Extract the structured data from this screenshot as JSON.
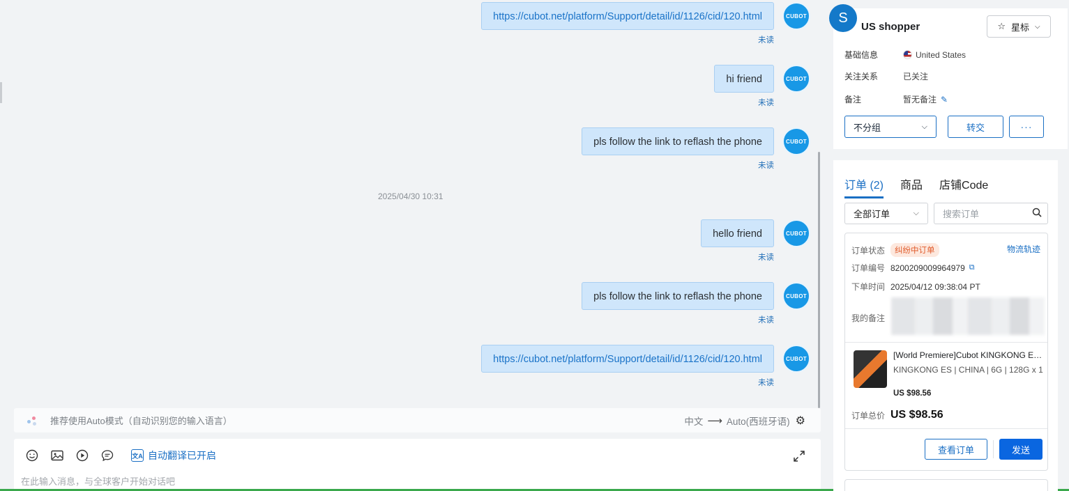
{
  "chat": {
    "avatar_label": "CUBOT",
    "time_separator": "2025/04/30 10:31",
    "messages": [
      {
        "text": "https://cubot.net/platform/Support/detail/id/1126/cid/120.html",
        "status": "未读",
        "is_link": true
      },
      {
        "text": "hi friend",
        "status": "未读",
        "is_link": false
      },
      {
        "text": "pls follow the link to reflash the phone",
        "status": "未读",
        "is_link": false
      },
      {
        "text": "hello friend",
        "status": "未读",
        "is_link": false
      },
      {
        "text": "pls follow the link to reflash the phone",
        "status": "未读",
        "is_link": false
      },
      {
        "text": "https://cubot.net/platform/Support/detail/id/1126/cid/120.html",
        "status": "未读",
        "is_link": true
      }
    ]
  },
  "translate_bar": {
    "hint": "推荐使用Auto模式（自动识别您的输入语言）",
    "source_lang": "中文",
    "target_lang": "Auto(西班牙语)"
  },
  "composer": {
    "auto_translate_label": "自动翻译已开启",
    "placeholder": "在此输入消息，与全球客户开始对话吧",
    "value": ""
  },
  "profile": {
    "avatar_letter": "S",
    "name": "US shopper",
    "star_label": "星标",
    "rows": [
      {
        "key": "基础信息",
        "value": "United States"
      },
      {
        "key": "关注关系",
        "value": "已关注"
      },
      {
        "key": "备注",
        "value": "暂无备注"
      }
    ],
    "group_select": "不分组",
    "transfer_label": "转交",
    "more_label": "···"
  },
  "orders": {
    "tabs": [
      {
        "label": "订单 (2)",
        "active": true
      },
      {
        "label": "商品",
        "active": false
      },
      {
        "label": "店铺Code",
        "active": false
      }
    ],
    "filter_select": "全部订单",
    "search_placeholder": "搜索订单",
    "card": {
      "status_key": "订单状态",
      "status_value": "纠纷中订单",
      "track_label": "物流轨迹",
      "number_key": "订单编号",
      "number_value": "8200209009964979",
      "time_key": "下单时间",
      "time_value": "2025/04/12 09:38:04 PT",
      "note_key": "我的备注",
      "product_title": "[World Premiere]Cubot KINGKONG ES Rugged Smartphone",
      "product_spec": "KINGKONG ES | CHINA | 6G | 128G x 1",
      "product_price": "US $98.56",
      "total_key": "订单总价",
      "total_value": "US $98.56",
      "view_label": "查看订单",
      "send_label": "发送"
    }
  },
  "colors": {
    "accent": "#1a6fc4",
    "bubble": "#cfe6fb",
    "send_button": "#0a66e0",
    "status_tag": "#e05a2a"
  }
}
